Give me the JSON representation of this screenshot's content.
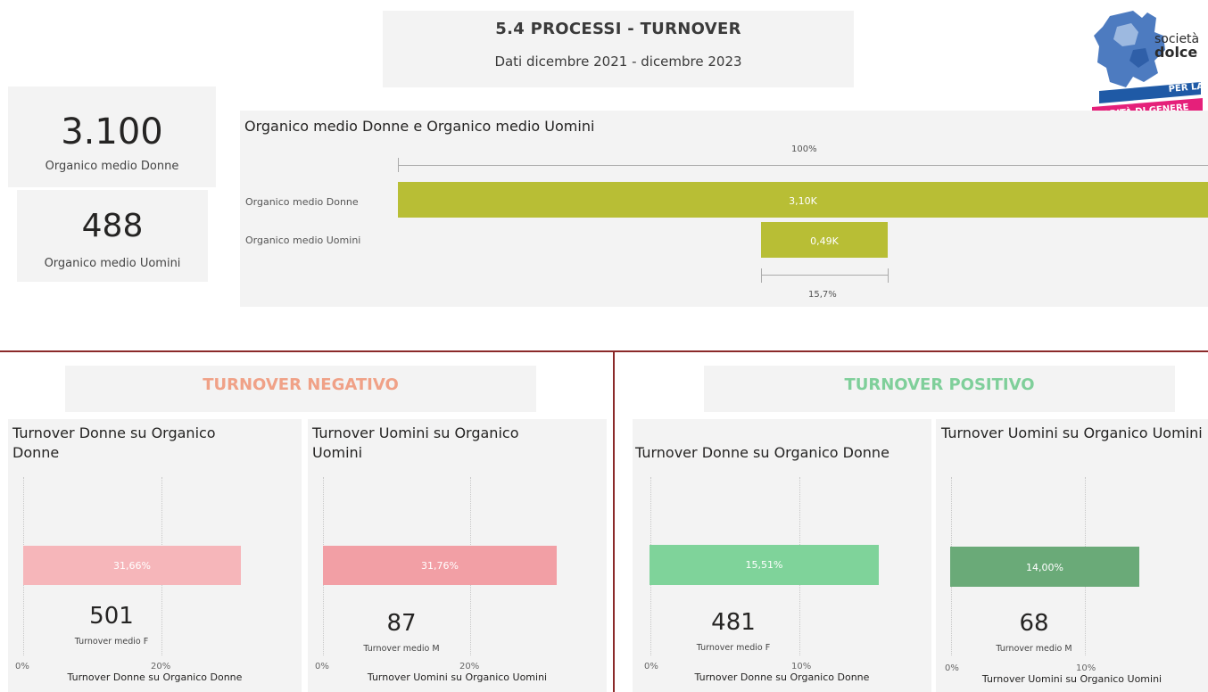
{
  "header": {
    "title": "5.4 PROCESSI - TURNOVER",
    "subtitle": "Dati dicembre 2021 - dicembre 2023"
  },
  "logo": {
    "line1": "società",
    "line2": "dolce",
    "band1": "PER LA",
    "band2": "PARITÀ DI GENERE",
    "colors": {
      "puzzle": "#4d7bc0",
      "band_blue": "#1f5aa6",
      "band_pink": "#e5207a"
    }
  },
  "kpis": [
    {
      "value": "3.100",
      "label": "Organico medio Donne"
    },
    {
      "value": "488",
      "label": "Organico medio Uomini"
    }
  ],
  "organico_chart": {
    "title": "Organico medio Donne e Organico medio Uomini",
    "top_label": "100%",
    "bottom_label": "15,7%",
    "color": "#b8be35"
  },
  "turnover_negativo": {
    "heading": "TURNOVER NEGATIVO",
    "color": "#f0a187"
  },
  "turnover_positivo": {
    "heading": "TURNOVER POSITIVO",
    "color": "#7fcf9a"
  },
  "panels": [
    {
      "title": "Turnover Donne su Organico Donne",
      "bar_label": "31,66%",
      "value": "501",
      "value_label": "Turnover medio F",
      "ticks": [
        "0%",
        "20%"
      ],
      "axis_title": "Turnover Donne su Organico Donne",
      "color": "#f6b6ba"
    },
    {
      "title": "Turnover Uomini su Organico Uomini",
      "bar_label": "31,76%",
      "value": "87",
      "value_label": "Turnover medio M",
      "ticks": [
        "0%",
        "20%"
      ],
      "axis_title": "Turnover Uomini su Organico Uomini",
      "color": "#f29fa5"
    },
    {
      "title": "Turnover Donne su Organico Donne",
      "bar_label": "15,51%",
      "value": "481",
      "value_label": "Turnover medio F",
      "ticks": [
        "0%",
        "10%"
      ],
      "axis_title": "Turnover Donne su Organico Donne",
      "color": "#7fd39a"
    },
    {
      "title": "Turnover Uomini su Organico Uomini",
      "bar_label": "14,00%",
      "value": "68",
      "value_label": "Turnover medio M",
      "ticks": [
        "0%",
        "10%"
      ],
      "axis_title": "Turnover Uomini su Organico Uomini",
      "color": "#6aaa78"
    }
  ],
  "chart_data": [
    {
      "type": "bar",
      "title": "Organico medio Donne e Organico medio Uomini",
      "categories": [
        "Organico medio Donne",
        "Organico medio Uomini"
      ],
      "values": [
        3100,
        488
      ],
      "data_labels": [
        "3,10K",
        "0,49K"
      ],
      "annotations": [
        "100%",
        "15,7%"
      ]
    },
    {
      "type": "bar",
      "title": "Turnover Donne su Organico Donne",
      "values": [
        31.66
      ],
      "data_labels": [
        "31,66%"
      ],
      "xlabel": "Turnover Donne su Organico Donne",
      "ticks": [
        "0%",
        "20%"
      ]
    },
    {
      "type": "bar",
      "title": "Turnover Uomini su Organico Uomini",
      "values": [
        31.76
      ],
      "data_labels": [
        "31,76%"
      ],
      "xlabel": "Turnover Uomini su Organico Uomini",
      "ticks": [
        "0%",
        "20%"
      ]
    },
    {
      "type": "bar",
      "title": "Turnover Donne su Organico Donne",
      "values": [
        15.51
      ],
      "data_labels": [
        "15,51%"
      ],
      "xlabel": "Turnover Donne su Organico Donne",
      "ticks": [
        "0%",
        "10%"
      ]
    },
    {
      "type": "bar",
      "title": "Turnover Uomini su Organico Uomini",
      "values": [
        14.0
      ],
      "data_labels": [
        "14,00%"
      ],
      "xlabel": "Turnover Uomini su Organico Uomini",
      "ticks": [
        "0%",
        "10%"
      ]
    }
  ]
}
